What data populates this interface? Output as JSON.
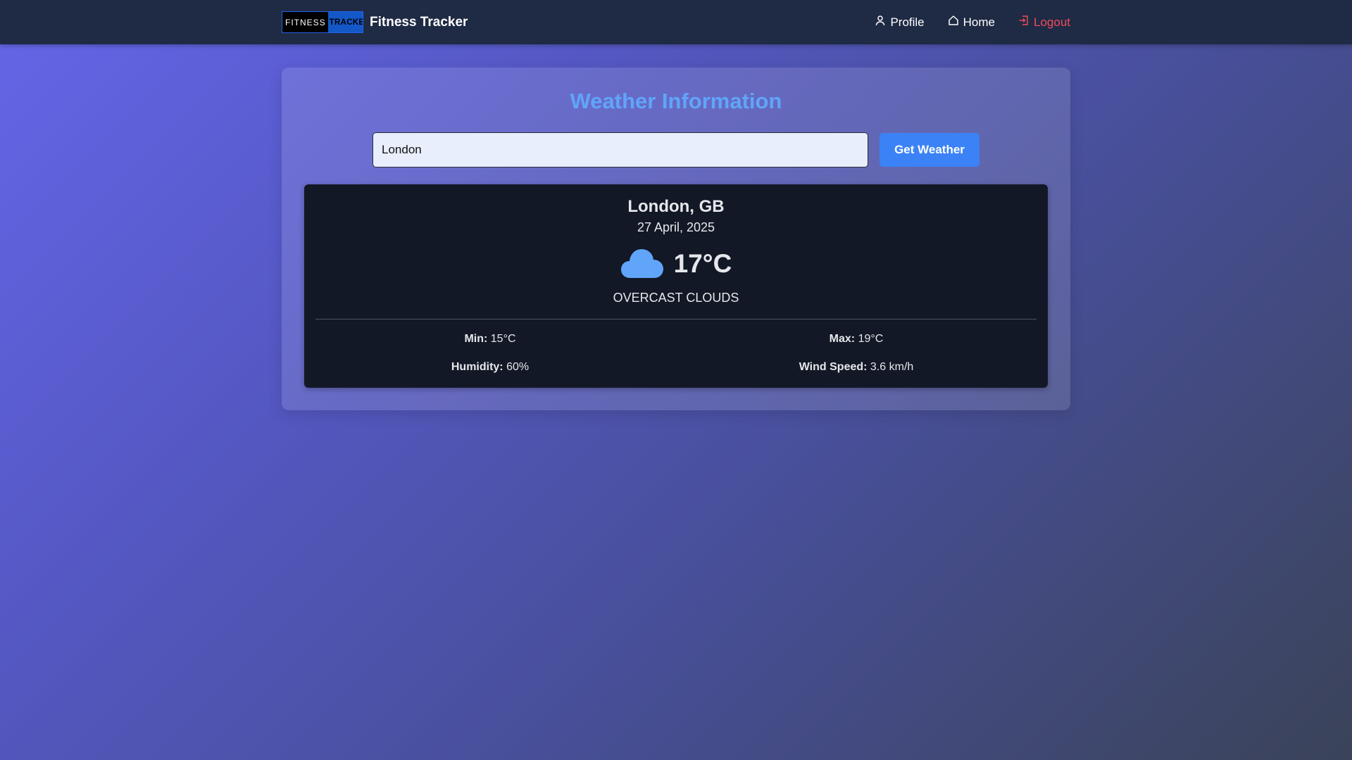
{
  "nav": {
    "logo_left": "FITNESS",
    "logo_right": "TRACKER",
    "title": "Fitness Tracker",
    "links": [
      {
        "label": "Profile",
        "icon": "user-icon"
      },
      {
        "label": "Home",
        "icon": "home-icon"
      },
      {
        "label": "Logout",
        "icon": "logout-icon"
      }
    ]
  },
  "main": {
    "title": "Weather Information",
    "search": {
      "value": "London",
      "placeholder": ""
    },
    "button_label": "Get Weather"
  },
  "weather": {
    "city": "London, GB",
    "date": "27 April, 2025",
    "icon": "cloud-icon",
    "temperature": "17°C",
    "description": "OVERCAST CLOUDS",
    "min_label": "Min:",
    "min_value": "15°C",
    "max_label": "Max:",
    "max_value": "19°C",
    "humidity_label": "Humidity:",
    "humidity_value": "60%",
    "wind_label": "Wind Speed:",
    "wind_value": "3.6 km/h"
  },
  "colors": {
    "accent": "#3b82f6",
    "title": "#60a5fa",
    "logout": "#f04c5a",
    "navbar": "#1f2a44",
    "panel": "#121826"
  }
}
